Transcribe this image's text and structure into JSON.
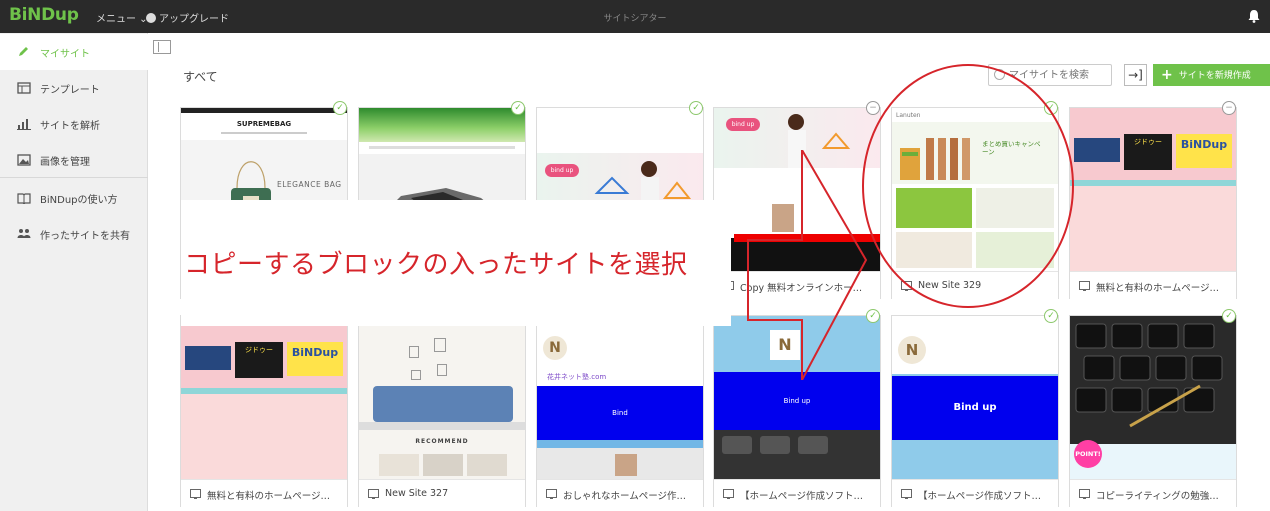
{
  "app": {
    "logo": "BiNDup",
    "menu_label": "メニュー ⌄",
    "upgrade_label": "アップグレード",
    "window_title": "サイトシアター"
  },
  "sidebar": {
    "items": [
      {
        "label": "マイサイト",
        "icon": "pencil-icon",
        "active": true
      },
      {
        "label": "テンプレート",
        "icon": "template-icon"
      },
      {
        "label": "サイトを解析",
        "icon": "chart-icon"
      },
      {
        "label": "画像を管理",
        "icon": "image-icon"
      },
      {
        "label": "BiNDupの使い方",
        "icon": "book-icon"
      },
      {
        "label": "作ったサイトを共有",
        "icon": "users-icon"
      }
    ]
  },
  "main": {
    "section_title": "すべて",
    "search_placeholder": "マイサイトを検索",
    "import_label": "→]",
    "new_site_label": "サイトを新規作成"
  },
  "overlay": {
    "text": "コピーするブロックの入ったサイトを選択"
  },
  "thumb_texts": {
    "supreme": "SUPREMEBAG",
    "elegance": "ELEGANCE BAG",
    "bindup_logo": "BiNDup",
    "jidou": "ジドゥー",
    "recommend": "RECOMMEND",
    "bind": "Bind",
    "bind_up": "Bind up",
    "bind_up_lower": "bind up",
    "n_letter": "N",
    "hanai": "花井ネット塾.com",
    "point": "POINT!",
    "campaign": "まとめ買いキャンペーン",
    "rakuten": "Lanuten"
  },
  "cards_row1": [
    {
      "title": "",
      "badge": "check"
    },
    {
      "title": "",
      "badge": "check"
    },
    {
      "title": "",
      "badge": "check"
    },
    {
      "title": "Copy 無料オンラインホー…",
      "badge": "minus"
    },
    {
      "title": "New Site 329",
      "badge": "check"
    },
    {
      "title": "無料と有料のホームページ…",
      "badge": "minus"
    }
  ],
  "cards_row2": [
    {
      "title": "無料と有料のホームページ…"
    },
    {
      "title": "New Site 327"
    },
    {
      "title": "おしゃれなホームページ作…"
    },
    {
      "title": "【ホームページ作成ソフト…",
      "badge": "check"
    },
    {
      "title": "【ホームページ作成ソフト…",
      "badge": "check"
    },
    {
      "title": "コピーライティングの勉強…",
      "badge": "check"
    }
  ],
  "colors": {
    "brand": "#6fc24a",
    "annotation": "#d6252b",
    "topbar": "#2a2a2a"
  }
}
